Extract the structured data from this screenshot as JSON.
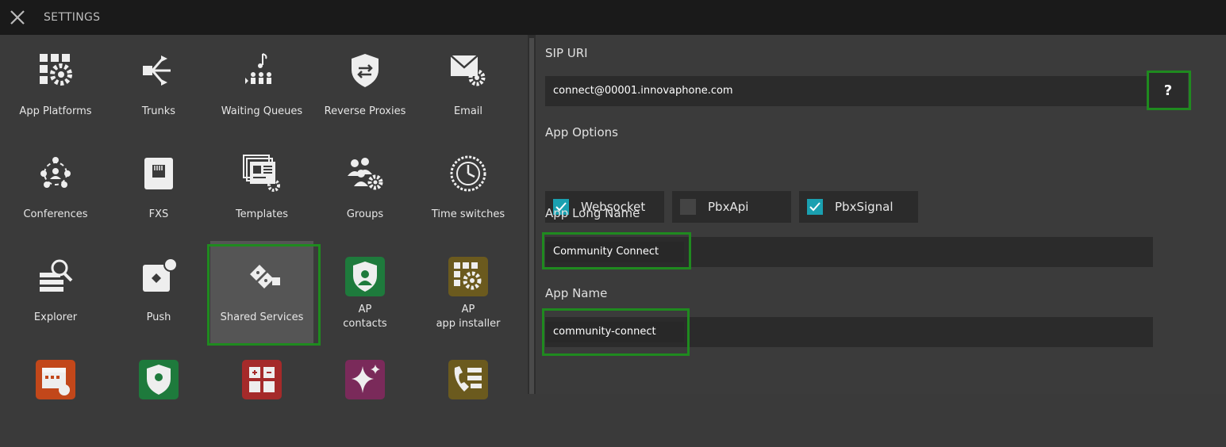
{
  "header": {
    "title": "SETTINGS",
    "close_icon": "close-icon"
  },
  "grid": [
    {
      "label": "App Platforms",
      "icon": "app-platforms-icon"
    },
    {
      "label": "Trunks",
      "icon": "trunks-icon"
    },
    {
      "label": "Waiting Queues",
      "icon": "waiting-queues-icon"
    },
    {
      "label": "Reverse Proxies",
      "icon": "reverse-proxies-icon"
    },
    {
      "label": "Email",
      "icon": "email-icon"
    },
    {
      "label": "Conferences",
      "icon": "conferences-icon"
    },
    {
      "label": "FXS",
      "icon": "fxs-icon"
    },
    {
      "label": "Templates",
      "icon": "templates-icon"
    },
    {
      "label": "Groups",
      "icon": "groups-icon"
    },
    {
      "label": "Time switches",
      "icon": "time-switches-icon"
    },
    {
      "label": "Explorer",
      "icon": "explorer-icon"
    },
    {
      "label": "Push",
      "icon": "push-icon"
    },
    {
      "label": "Shared Services",
      "icon": "shared-services-icon",
      "selected": true
    },
    {
      "label": "AP",
      "label2": "contacts",
      "icon": "ap-contacts-icon",
      "color": "#1e7a3c"
    },
    {
      "label": "AP",
      "label2": "app installer",
      "icon": "ap-app-installer-icon",
      "color": "#6b5a1e"
    },
    {
      "label": "",
      "icon": "calendar-icon",
      "color": "#c2471a"
    },
    {
      "label": "",
      "icon": "user-shield-icon",
      "color": "#1e7a3c"
    },
    {
      "label": "",
      "icon": "calculator-icon",
      "color": "#a52a2a"
    },
    {
      "label": "",
      "icon": "sparkle-icon",
      "color": "#7a2a5a"
    },
    {
      "label": "",
      "icon": "phone-list-icon",
      "color": "#6b5a1e"
    }
  ],
  "form": {
    "sip_uri_label": "SIP URI",
    "sip_uri_value": "connect@00001.innovaphone.com",
    "help_label": "?",
    "app_options_label": "App Options",
    "options": [
      {
        "label": "Websocket",
        "checked": true
      },
      {
        "label": "PbxApi",
        "checked": false
      },
      {
        "label": "PbxSignal",
        "checked": true
      }
    ],
    "app_long_name_label": "App Long Name",
    "app_long_name_value": "Community Connect",
    "app_name_label": "App Name",
    "app_name_value": "community-connect"
  },
  "colors": {
    "highlight": "#1f8a1f",
    "checkbox": "#1aa0b0"
  }
}
